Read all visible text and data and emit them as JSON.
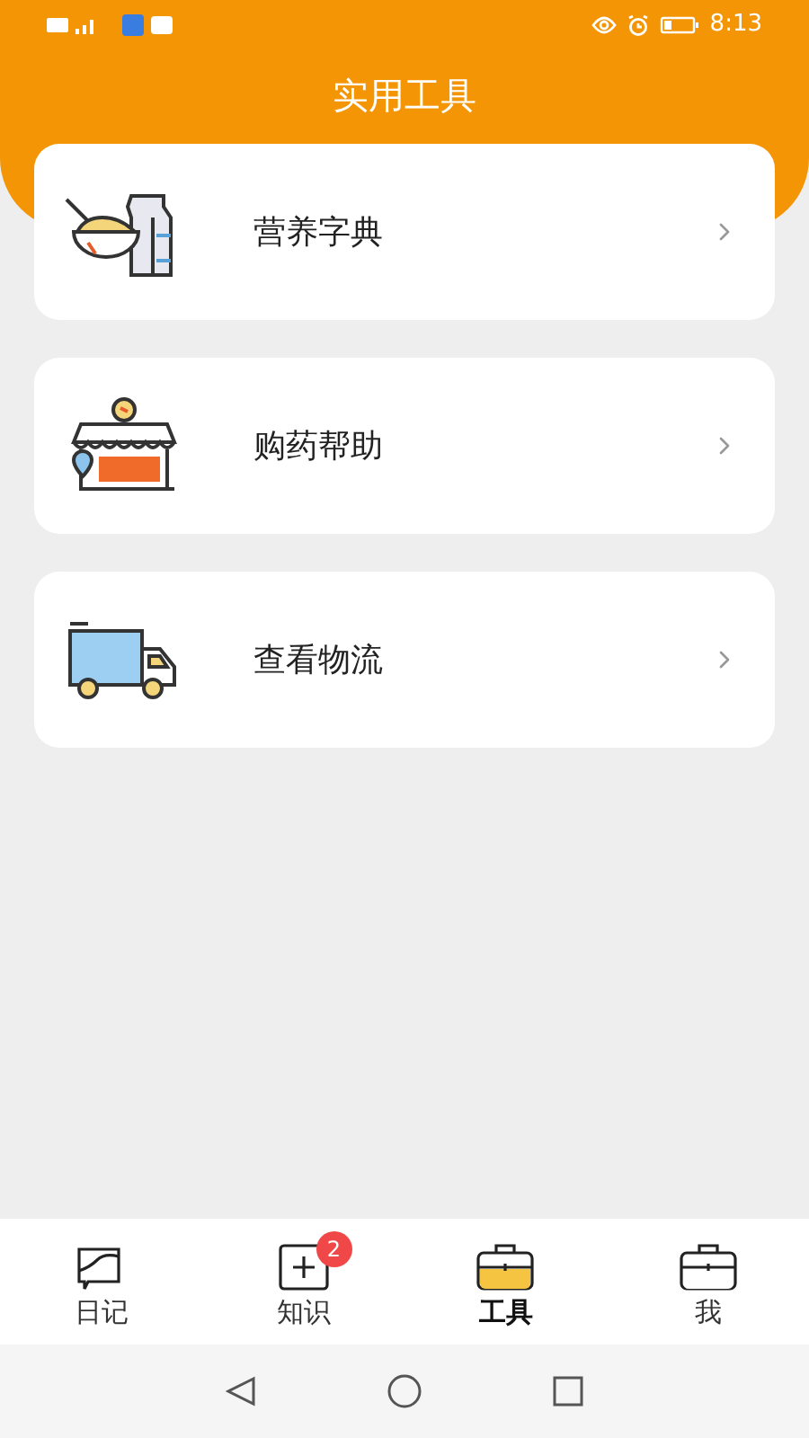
{
  "status_bar": {
    "time": "8:13"
  },
  "title": "实用工具",
  "tools": [
    {
      "kind": "nutrition",
      "label": "营养字典"
    },
    {
      "kind": "pharmacy",
      "label": "购药帮助"
    },
    {
      "kind": "delivery",
      "label": "查看物流"
    }
  ],
  "tabs": [
    {
      "kind": "diary",
      "label": "日记",
      "selected": false
    },
    {
      "kind": "knowledge",
      "label": "知识",
      "selected": false,
      "badge": "2"
    },
    {
      "kind": "tools",
      "label": "工具",
      "selected": true
    },
    {
      "kind": "me",
      "label": "我",
      "selected": false
    }
  ]
}
